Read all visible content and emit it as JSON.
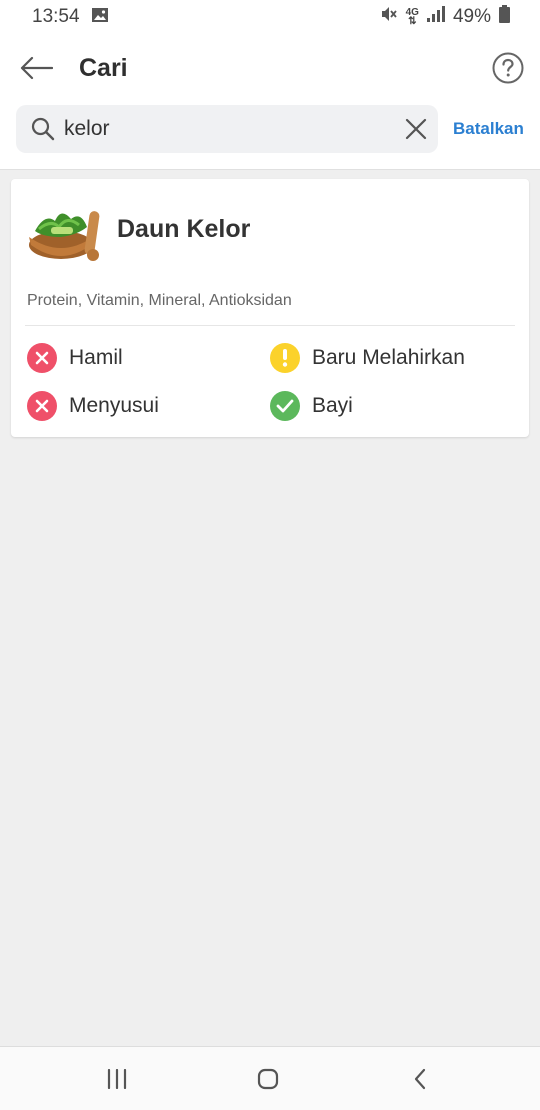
{
  "status_bar": {
    "time": "13:54",
    "network": "4G",
    "battery": "49%",
    "icons": [
      "image-icon",
      "mute-icon",
      "signal-icon",
      "battery-icon"
    ]
  },
  "header": {
    "title": "Cari",
    "back_icon": "arrow-left-icon",
    "help_icon": "help-circle-icon"
  },
  "search": {
    "value": "kelor",
    "placeholder": "",
    "search_icon": "search-icon",
    "clear_icon": "close-icon",
    "cancel_label": "Batalkan"
  },
  "result": {
    "name": "Daun Kelor",
    "nutrients": "Protein, Vitamin, Mineral, Antioksidan",
    "statuses": [
      {
        "label": "Hamil",
        "status": "not-recommended",
        "color": "#ef5069"
      },
      {
        "label": "Baru Melahirkan",
        "status": "caution",
        "color": "#fbd22b"
      },
      {
        "label": "Menyusui",
        "status": "not-recommended",
        "color": "#ef5069"
      },
      {
        "label": "Bayi",
        "status": "safe",
        "color": "#5cb85c"
      }
    ]
  },
  "colors": {
    "accent": "#2b7fd1",
    "background": "#efefef"
  },
  "navigation": {
    "items": [
      "recent-apps-icon",
      "home-icon",
      "back-icon"
    ]
  }
}
